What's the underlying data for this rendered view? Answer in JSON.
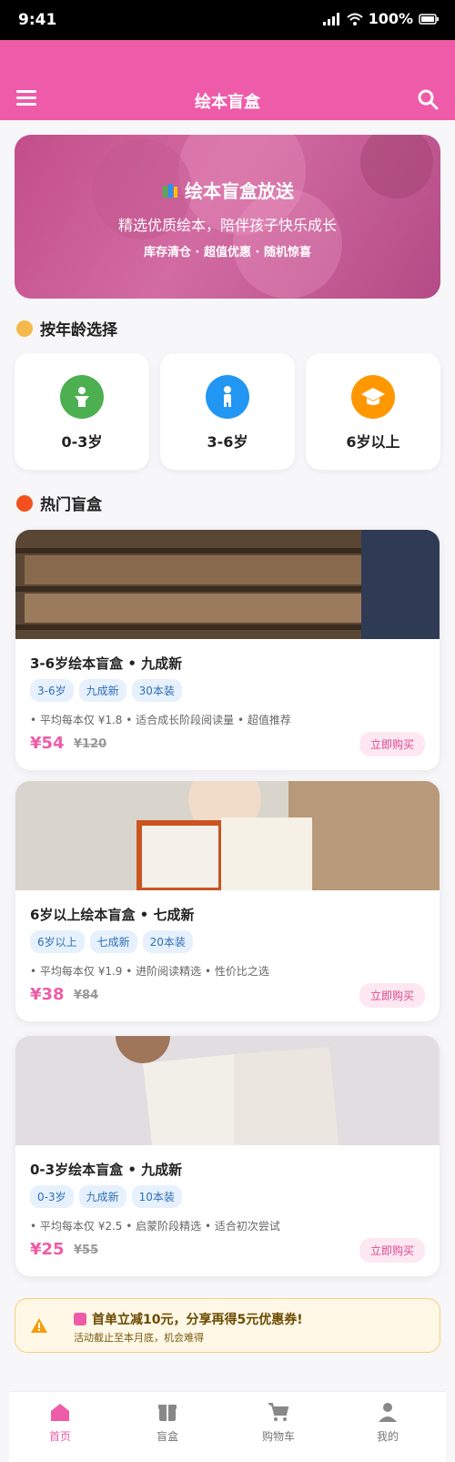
{
  "status": {
    "time": "9:41",
    "battery": "100%"
  },
  "header": {
    "title": "绘本盲盒"
  },
  "hero": {
    "title": "绘本盲盒放送",
    "subtitle": "精选优质绘本，陪伴孩子快乐成长",
    "tags": "库存清仓 · 超值优惠 · 随机惊喜"
  },
  "age_section": {
    "title": "按年龄选择",
    "items": [
      {
        "label": "0-3岁",
        "color": "#4caf50",
        "icon": "baby-icon"
      },
      {
        "label": "3-6岁",
        "color": "#2196f3",
        "icon": "child-icon"
      },
      {
        "label": "6岁以上",
        "color": "#ff9800",
        "icon": "graduation-cap-icon"
      }
    ]
  },
  "hot_section": {
    "title": "热门盲盒"
  },
  "products": [
    {
      "title": "3-6岁绘本盲盒 • 九成新",
      "tags": [
        "3-6岁",
        "九成新",
        "30本装"
      ],
      "desc": "• 平均每本仅 ¥1.8 • 适合成长阶段阅读量 • 超值推荐",
      "price": "¥54",
      "old_price": "¥120",
      "buy": "立即购买"
    },
    {
      "title": "6岁以上绘本盲盒 • 七成新",
      "tags": [
        "6岁以上",
        "七成新",
        "20本装"
      ],
      "desc": "• 平均每本仅 ¥1.9 • 进阶阅读精选 • 性价比之选",
      "price": "¥38",
      "old_price": "¥84",
      "buy": "立即购买"
    },
    {
      "title": "0-3岁绘本盲盒 • 九成新",
      "tags": [
        "0-3岁",
        "九成新",
        "10本装"
      ],
      "desc": "• 平均每本仅 ¥2.5 • 启蒙阶段精选 • 适合初次尝试",
      "price": "¥25",
      "old_price": "¥55",
      "buy": "立即购买"
    }
  ],
  "notice": {
    "title": "首单立减10元，分享再得5元优惠券!",
    "sub": "活动截止至本月底，机会难得"
  },
  "tabs": [
    {
      "label": "首页",
      "icon": "home-icon",
      "active": true
    },
    {
      "label": "盲盒",
      "icon": "box-icon"
    },
    {
      "label": "购物车",
      "icon": "cart-icon"
    },
    {
      "label": "我的",
      "icon": "user-icon"
    }
  ],
  "colors": {
    "accent": "#ee5ba8",
    "tag_bg": "#e6f1fd",
    "tag_text": "#2f6fb8"
  }
}
